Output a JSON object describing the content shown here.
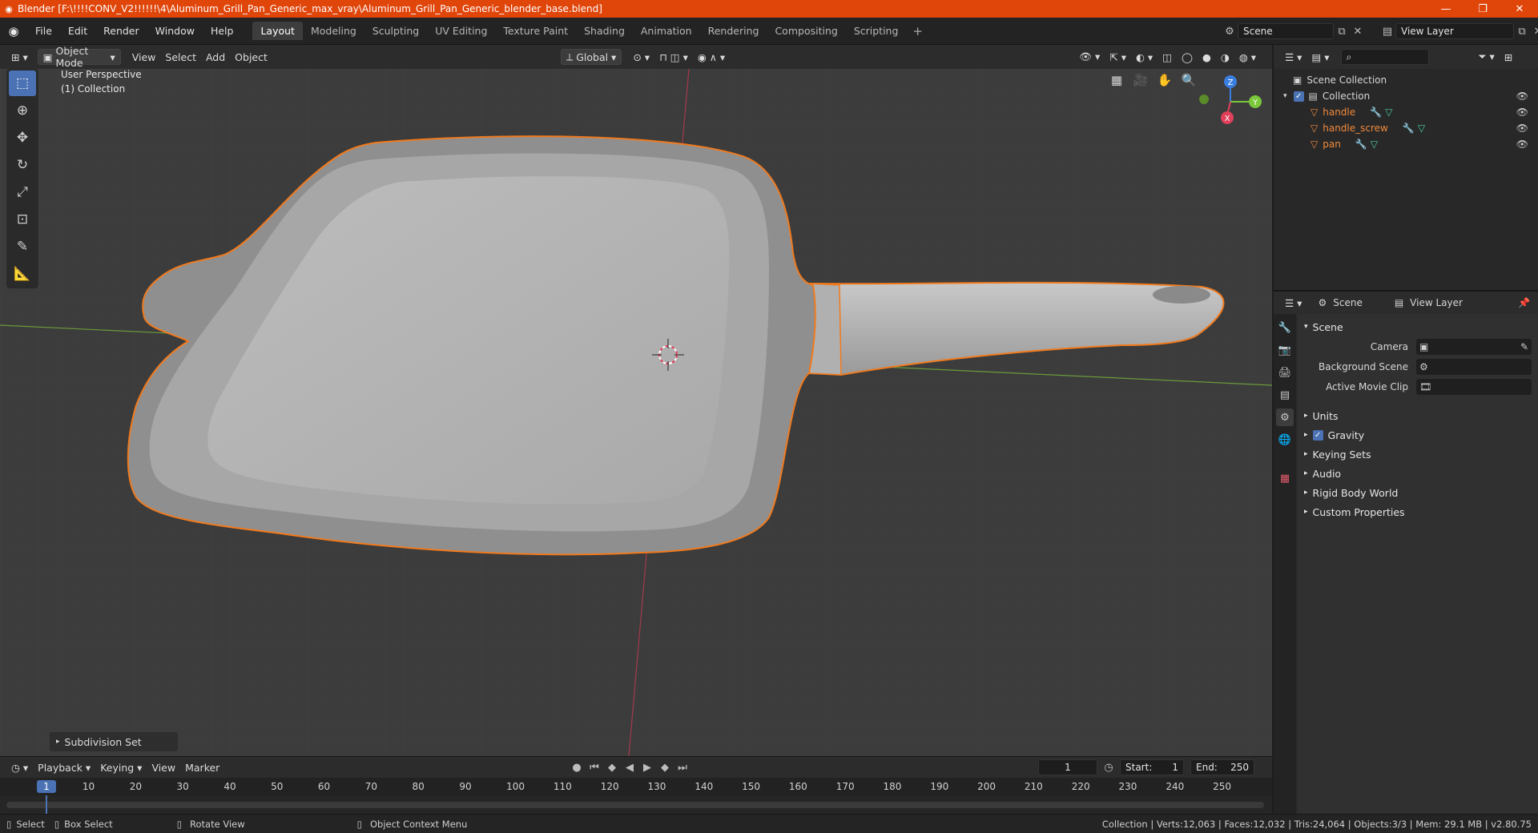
{
  "window": {
    "title": "Blender [F:\\!!!!CONV_V2!!!!!!\\4\\Aluminum_Grill_Pan_Generic_max_vray\\Aluminum_Grill_Pan_Generic_blender_base.blend]",
    "minimize": "—",
    "maximize": "❐",
    "close": "✕"
  },
  "menu": [
    "File",
    "Edit",
    "Render",
    "Window",
    "Help"
  ],
  "workspaces": [
    "Layout",
    "Modeling",
    "Sculpting",
    "UV Editing",
    "Texture Paint",
    "Shading",
    "Animation",
    "Rendering",
    "Compositing",
    "Scripting"
  ],
  "workspace_add": "+",
  "scene": {
    "name": "Scene",
    "view_layer": "View Layer"
  },
  "viewport_header": {
    "mode": "Object Mode",
    "menus": [
      "View",
      "Select",
      "Add",
      "Object"
    ],
    "orientation": "Global"
  },
  "viewport": {
    "perspective": "User Perspective",
    "collection": "(1) Collection",
    "gizmo": {
      "x": "X",
      "y": "Y",
      "z": "Z"
    },
    "operator_panel": "Subdivision Set"
  },
  "outliner": {
    "root": "Scene Collection",
    "collection": "Collection",
    "objects": [
      "handle",
      "handle_screw",
      "pan"
    ]
  },
  "properties": {
    "header_scene": "Scene",
    "header_view_layer": "View Layer",
    "section_scene": "Scene",
    "fields": [
      {
        "label": "Camera",
        "value": ""
      },
      {
        "label": "Background Scene",
        "value": ""
      },
      {
        "label": "Active Movie Clip",
        "value": ""
      }
    ],
    "sections": [
      "Units",
      "Gravity",
      "Keying Sets",
      "Audio",
      "Rigid Body World",
      "Custom Properties"
    ]
  },
  "timeline": {
    "menus": [
      "Playback",
      "Keying",
      "View",
      "Marker"
    ],
    "current_frame": "1",
    "start_label": "Start:",
    "start": "1",
    "end_label": "End:",
    "end": "250",
    "ticks": [
      "10",
      "20",
      "30",
      "40",
      "50",
      "60",
      "70",
      "80",
      "90",
      "100",
      "110",
      "120",
      "130",
      "140",
      "150",
      "160",
      "170",
      "180",
      "190",
      "200",
      "210",
      "220",
      "230",
      "240",
      "250"
    ]
  },
  "statusbar": {
    "select": "Select",
    "box_select": "Box Select",
    "rotate": "Rotate View",
    "context": "Object Context Menu",
    "stats": "Collection | Verts:12,063 | Faces:12,032 | Tris:24,064 | Objects:3/3 | Mem: 29.1 MB | v2.80.75"
  },
  "colors": {
    "titlebar": "#e0450a",
    "accent": "#4a72b4",
    "selection_outline": "#f07a1e",
    "axis_x": "#e0405a",
    "axis_y": "#7ac83a",
    "axis_z": "#3a7ee0"
  }
}
